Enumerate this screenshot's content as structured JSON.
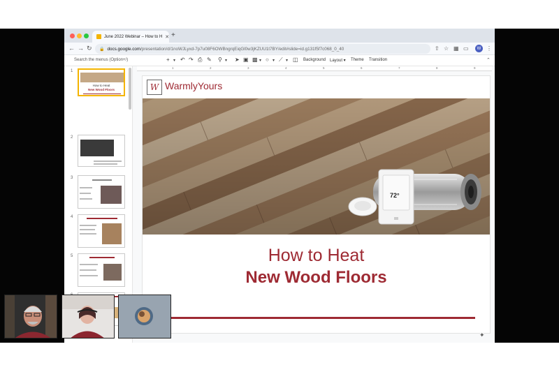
{
  "browser": {
    "tab_title": "June 2022 Webinar – How to H",
    "tab_close": "✕",
    "new_tab": "+",
    "url_host": "docs.google.com",
    "url_path": "/presentation/d/1noWJLyxd-7p7u08F6OWBngrqEiqGl0w3jKZUU1t7BY/edit#slide=id.g131f5f7c068_0_40",
    "profile_initial": "W",
    "colors": {
      "tab_strip": "#dee3ea",
      "omnibox": "#e9edf2",
      "accent": "#9e2a33"
    }
  },
  "toolbar": {
    "search_menus": "Search the menus (Option+/)",
    "background": "Background",
    "layout": "Layout ▾",
    "theme": "Theme",
    "transition": "Transition"
  },
  "filmstrip": {
    "slides": [
      {
        "number": "1",
        "title": "How to Heat",
        "subtitle": "New Wood Floors",
        "active": true
      },
      {
        "number": "2",
        "active": false
      },
      {
        "number": "3",
        "active": false
      },
      {
        "number": "4",
        "active": false
      },
      {
        "number": "5",
        "active": false
      },
      {
        "number": "6",
        "active": false
      }
    ]
  },
  "ruler": [
    "1",
    "2",
    "3",
    "4",
    "5",
    "6",
    "7",
    "8",
    "9"
  ],
  "slide": {
    "logo_mark": "W",
    "logo_text": "WarmlyYours",
    "title": "How to Heat",
    "subtitle": "New Wood Floors",
    "thermostat_temp": "72°",
    "icon_name": "wood-floor-heating-photo"
  },
  "cams": [
    {
      "icon": "presenter-video"
    },
    {
      "icon": "presenter-video"
    },
    {
      "icon": "participant-avatar"
    }
  ]
}
